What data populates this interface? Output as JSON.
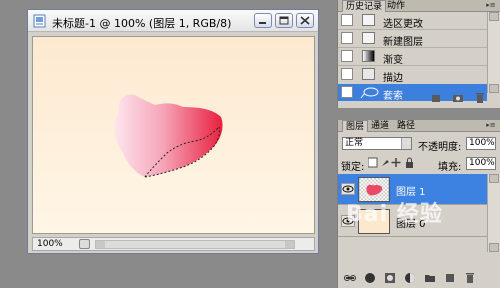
{
  "document": {
    "title": "未标题-1 @ 100% (图层 1, RGB/8)",
    "zoom": "100%"
  },
  "history_panel": {
    "tabs": [
      {
        "label": "历史记录"
      },
      {
        "label": "动作"
      }
    ],
    "items": [
      {
        "label": "选区更改",
        "icon": "selection-icon"
      },
      {
        "label": "新建图层",
        "icon": "new-layer-icon"
      },
      {
        "label": "渐变",
        "icon": "gradient-icon"
      },
      {
        "label": "描边",
        "icon": "stroke-icon"
      },
      {
        "label": "套索",
        "icon": "lasso-icon",
        "selected": true
      }
    ]
  },
  "layers_panel": {
    "tabs": [
      {
        "label": "图层"
      },
      {
        "label": "通道"
      },
      {
        "label": "路径"
      }
    ],
    "blend_mode": "正常",
    "opacity_label": "不透明度:",
    "opacity_value": "100%",
    "lock_label": "锁定:",
    "fill_label": "填充:",
    "fill_value": "100%",
    "layers": [
      {
        "name": "图层 1",
        "selected": true
      },
      {
        "name": "图层 0",
        "selected": false
      }
    ]
  },
  "watermark": {
    "text": "Bai 经验"
  },
  "colors": {
    "selection": "#3c7fdc",
    "shape_light": "#fde5ee",
    "shape_dark": "#e8203f",
    "canvas_top": "#fde9d0",
    "canvas_bottom": "#fff6e6"
  }
}
